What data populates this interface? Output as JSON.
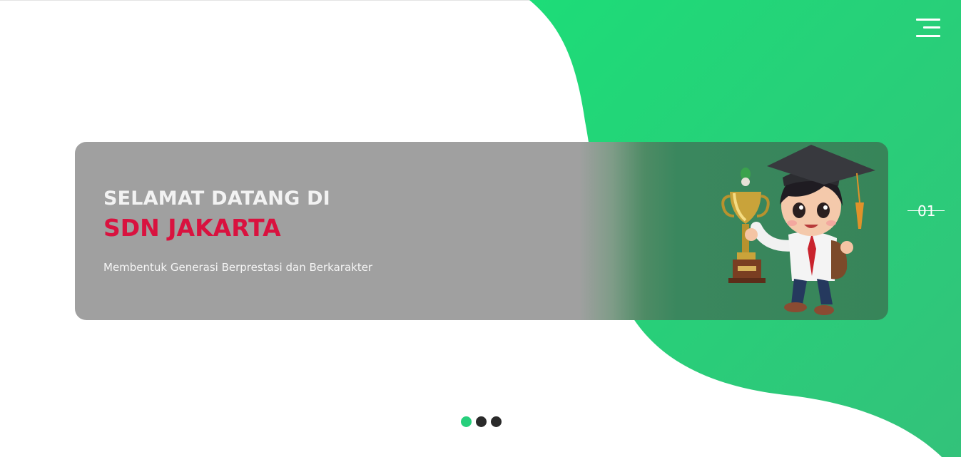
{
  "hero": {
    "title_line_1": "SELAMAT DATANG DI",
    "title_line_2": "SDN JAKARTA",
    "subtitle": "Membentuk Generasi Berprestasi dan Berkarakter"
  },
  "slider": {
    "current_slide": "01",
    "slide_count": 3,
    "active_index": 0
  },
  "icons": {
    "menu": "hamburger-menu-icon",
    "illustration": "student-with-trophy-illustration"
  },
  "colors": {
    "accent_green": "#27cf7c",
    "title_red": "#d9123f",
    "card_gray": "#a0a0a0",
    "card_green": "#378559",
    "dot_inactive": "#2a2a2a"
  }
}
